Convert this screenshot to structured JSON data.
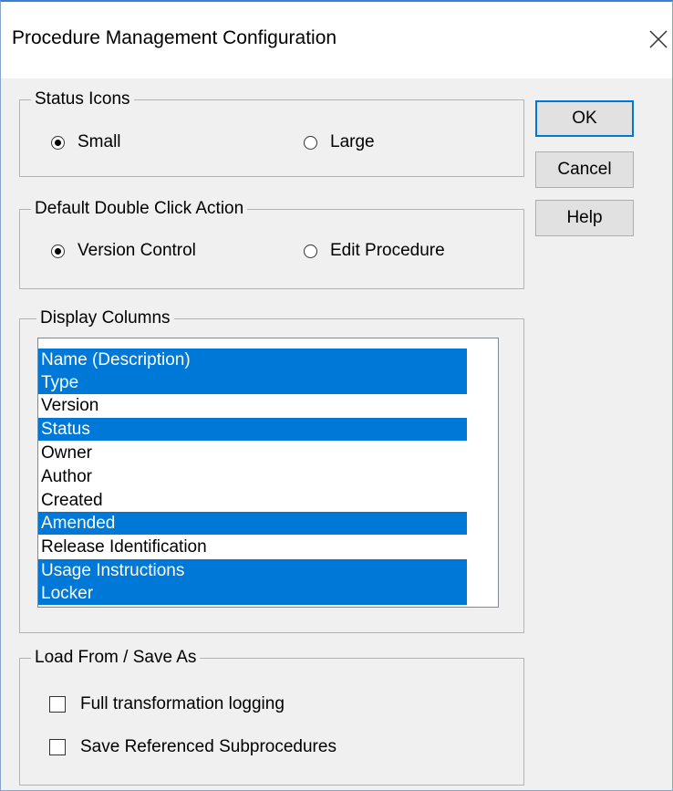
{
  "window": {
    "title": "Procedure Management Configuration"
  },
  "status_icons": {
    "legend": "Status Icons",
    "options": [
      {
        "label": "Small",
        "selected": true
      },
      {
        "label": "Large",
        "selected": false
      }
    ]
  },
  "double_click": {
    "legend": "Default Double Click Action",
    "options": [
      {
        "label": "Version Control",
        "selected": true
      },
      {
        "label": "Edit Procedure",
        "selected": false
      }
    ]
  },
  "display_columns": {
    "legend": "Display Columns",
    "items": [
      {
        "label": "Name (Description)",
        "selected": true
      },
      {
        "label": "Type",
        "selected": true
      },
      {
        "label": "Version",
        "selected": false
      },
      {
        "label": "Status",
        "selected": true
      },
      {
        "label": "Owner",
        "selected": false
      },
      {
        "label": "Author",
        "selected": false
      },
      {
        "label": "Created",
        "selected": false
      },
      {
        "label": "Amended",
        "selected": true
      },
      {
        "label": "Release Identification",
        "selected": false
      },
      {
        "label": "Usage Instructions",
        "selected": true
      },
      {
        "label": "Locker",
        "selected": true
      }
    ]
  },
  "load_save": {
    "legend": "Load From / Save As",
    "checkboxes": [
      {
        "label": "Full transformation logging",
        "checked": false
      },
      {
        "label": "Save Referenced Subprocedures",
        "checked": false
      }
    ]
  },
  "buttons": {
    "ok": "OK",
    "cancel": "Cancel",
    "help": "Help"
  },
  "colors": {
    "selection": "#0078d7",
    "window_border": "#3c7fd0",
    "dialog_bg": "#f0f0f0"
  }
}
